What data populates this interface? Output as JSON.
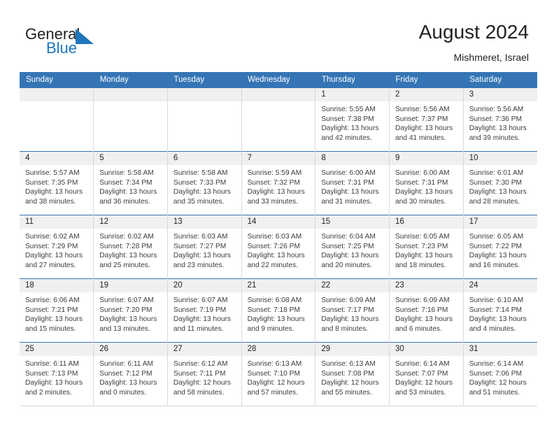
{
  "brand": {
    "name_part1": "General",
    "name_part2": "Blue",
    "logo_icon": "sail-triangle-icon",
    "accent_color": "#1f76bc"
  },
  "header": {
    "title": "August 2024",
    "location": "Mishmeret, Israel"
  },
  "theme": {
    "header_blue": "#3575b5",
    "daynum_strip_gray": "#f0f0f0",
    "grid_line": "#d9d9d9",
    "text": "#231f20"
  },
  "calendar": {
    "weekday_headers": [
      "Sunday",
      "Monday",
      "Tuesday",
      "Wednesday",
      "Thursday",
      "Friday",
      "Saturday"
    ],
    "weeks": [
      [
        {
          "day": "",
          "empty": true
        },
        {
          "day": "",
          "empty": true
        },
        {
          "day": "",
          "empty": true
        },
        {
          "day": "",
          "empty": true
        },
        {
          "day": "1",
          "sunrise": "Sunrise: 5:55 AM",
          "sunset": "Sunset: 7:38 PM",
          "daylight_line1": "Daylight: 13 hours",
          "daylight_line2": "and 42 minutes."
        },
        {
          "day": "2",
          "sunrise": "Sunrise: 5:56 AM",
          "sunset": "Sunset: 7:37 PM",
          "daylight_line1": "Daylight: 13 hours",
          "daylight_line2": "and 41 minutes."
        },
        {
          "day": "3",
          "sunrise": "Sunrise: 5:56 AM",
          "sunset": "Sunset: 7:36 PM",
          "daylight_line1": "Daylight: 13 hours",
          "daylight_line2": "and 39 minutes."
        }
      ],
      [
        {
          "day": "4",
          "sunrise": "Sunrise: 5:57 AM",
          "sunset": "Sunset: 7:35 PM",
          "daylight_line1": "Daylight: 13 hours",
          "daylight_line2": "and 38 minutes."
        },
        {
          "day": "5",
          "sunrise": "Sunrise: 5:58 AM",
          "sunset": "Sunset: 7:34 PM",
          "daylight_line1": "Daylight: 13 hours",
          "daylight_line2": "and 36 minutes."
        },
        {
          "day": "6",
          "sunrise": "Sunrise: 5:58 AM",
          "sunset": "Sunset: 7:33 PM",
          "daylight_line1": "Daylight: 13 hours",
          "daylight_line2": "and 35 minutes."
        },
        {
          "day": "7",
          "sunrise": "Sunrise: 5:59 AM",
          "sunset": "Sunset: 7:32 PM",
          "daylight_line1": "Daylight: 13 hours",
          "daylight_line2": "and 33 minutes."
        },
        {
          "day": "8",
          "sunrise": "Sunrise: 6:00 AM",
          "sunset": "Sunset: 7:31 PM",
          "daylight_line1": "Daylight: 13 hours",
          "daylight_line2": "and 31 minutes."
        },
        {
          "day": "9",
          "sunrise": "Sunrise: 6:00 AM",
          "sunset": "Sunset: 7:31 PM",
          "daylight_line1": "Daylight: 13 hours",
          "daylight_line2": "and 30 minutes."
        },
        {
          "day": "10",
          "sunrise": "Sunrise: 6:01 AM",
          "sunset": "Sunset: 7:30 PM",
          "daylight_line1": "Daylight: 13 hours",
          "daylight_line2": "and 28 minutes."
        }
      ],
      [
        {
          "day": "11",
          "sunrise": "Sunrise: 6:02 AM",
          "sunset": "Sunset: 7:29 PM",
          "daylight_line1": "Daylight: 13 hours",
          "daylight_line2": "and 27 minutes."
        },
        {
          "day": "12",
          "sunrise": "Sunrise: 6:02 AM",
          "sunset": "Sunset: 7:28 PM",
          "daylight_line1": "Daylight: 13 hours",
          "daylight_line2": "and 25 minutes."
        },
        {
          "day": "13",
          "sunrise": "Sunrise: 6:03 AM",
          "sunset": "Sunset: 7:27 PM",
          "daylight_line1": "Daylight: 13 hours",
          "daylight_line2": "and 23 minutes."
        },
        {
          "day": "14",
          "sunrise": "Sunrise: 6:03 AM",
          "sunset": "Sunset: 7:26 PM",
          "daylight_line1": "Daylight: 13 hours",
          "daylight_line2": "and 22 minutes."
        },
        {
          "day": "15",
          "sunrise": "Sunrise: 6:04 AM",
          "sunset": "Sunset: 7:25 PM",
          "daylight_line1": "Daylight: 13 hours",
          "daylight_line2": "and 20 minutes."
        },
        {
          "day": "16",
          "sunrise": "Sunrise: 6:05 AM",
          "sunset": "Sunset: 7:23 PM",
          "daylight_line1": "Daylight: 13 hours",
          "daylight_line2": "and 18 minutes."
        },
        {
          "day": "17",
          "sunrise": "Sunrise: 6:05 AM",
          "sunset": "Sunset: 7:22 PM",
          "daylight_line1": "Daylight: 13 hours",
          "daylight_line2": "and 16 minutes."
        }
      ],
      [
        {
          "day": "18",
          "sunrise": "Sunrise: 6:06 AM",
          "sunset": "Sunset: 7:21 PM",
          "daylight_line1": "Daylight: 13 hours",
          "daylight_line2": "and 15 minutes."
        },
        {
          "day": "19",
          "sunrise": "Sunrise: 6:07 AM",
          "sunset": "Sunset: 7:20 PM",
          "daylight_line1": "Daylight: 13 hours",
          "daylight_line2": "and 13 minutes."
        },
        {
          "day": "20",
          "sunrise": "Sunrise: 6:07 AM",
          "sunset": "Sunset: 7:19 PM",
          "daylight_line1": "Daylight: 13 hours",
          "daylight_line2": "and 11 minutes."
        },
        {
          "day": "21",
          "sunrise": "Sunrise: 6:08 AM",
          "sunset": "Sunset: 7:18 PM",
          "daylight_line1": "Daylight: 13 hours",
          "daylight_line2": "and 9 minutes."
        },
        {
          "day": "22",
          "sunrise": "Sunrise: 6:09 AM",
          "sunset": "Sunset: 7:17 PM",
          "daylight_line1": "Daylight: 13 hours",
          "daylight_line2": "and 8 minutes."
        },
        {
          "day": "23",
          "sunrise": "Sunrise: 6:09 AM",
          "sunset": "Sunset: 7:16 PM",
          "daylight_line1": "Daylight: 13 hours",
          "daylight_line2": "and 6 minutes."
        },
        {
          "day": "24",
          "sunrise": "Sunrise: 6:10 AM",
          "sunset": "Sunset: 7:14 PM",
          "daylight_line1": "Daylight: 13 hours",
          "daylight_line2": "and 4 minutes."
        }
      ],
      [
        {
          "day": "25",
          "sunrise": "Sunrise: 6:11 AM",
          "sunset": "Sunset: 7:13 PM",
          "daylight_line1": "Daylight: 13 hours",
          "daylight_line2": "and 2 minutes."
        },
        {
          "day": "26",
          "sunrise": "Sunrise: 6:11 AM",
          "sunset": "Sunset: 7:12 PM",
          "daylight_line1": "Daylight: 13 hours",
          "daylight_line2": "and 0 minutes."
        },
        {
          "day": "27",
          "sunrise": "Sunrise: 6:12 AM",
          "sunset": "Sunset: 7:11 PM",
          "daylight_line1": "Daylight: 12 hours",
          "daylight_line2": "and 58 minutes."
        },
        {
          "day": "28",
          "sunrise": "Sunrise: 6:13 AM",
          "sunset": "Sunset: 7:10 PM",
          "daylight_line1": "Daylight: 12 hours",
          "daylight_line2": "and 57 minutes."
        },
        {
          "day": "29",
          "sunrise": "Sunrise: 6:13 AM",
          "sunset": "Sunset: 7:08 PM",
          "daylight_line1": "Daylight: 12 hours",
          "daylight_line2": "and 55 minutes."
        },
        {
          "day": "30",
          "sunrise": "Sunrise: 6:14 AM",
          "sunset": "Sunset: 7:07 PM",
          "daylight_line1": "Daylight: 12 hours",
          "daylight_line2": "and 53 minutes."
        },
        {
          "day": "31",
          "sunrise": "Sunrise: 6:14 AM",
          "sunset": "Sunset: 7:06 PM",
          "daylight_line1": "Daylight: 12 hours",
          "daylight_line2": "and 51 minutes."
        }
      ]
    ]
  }
}
